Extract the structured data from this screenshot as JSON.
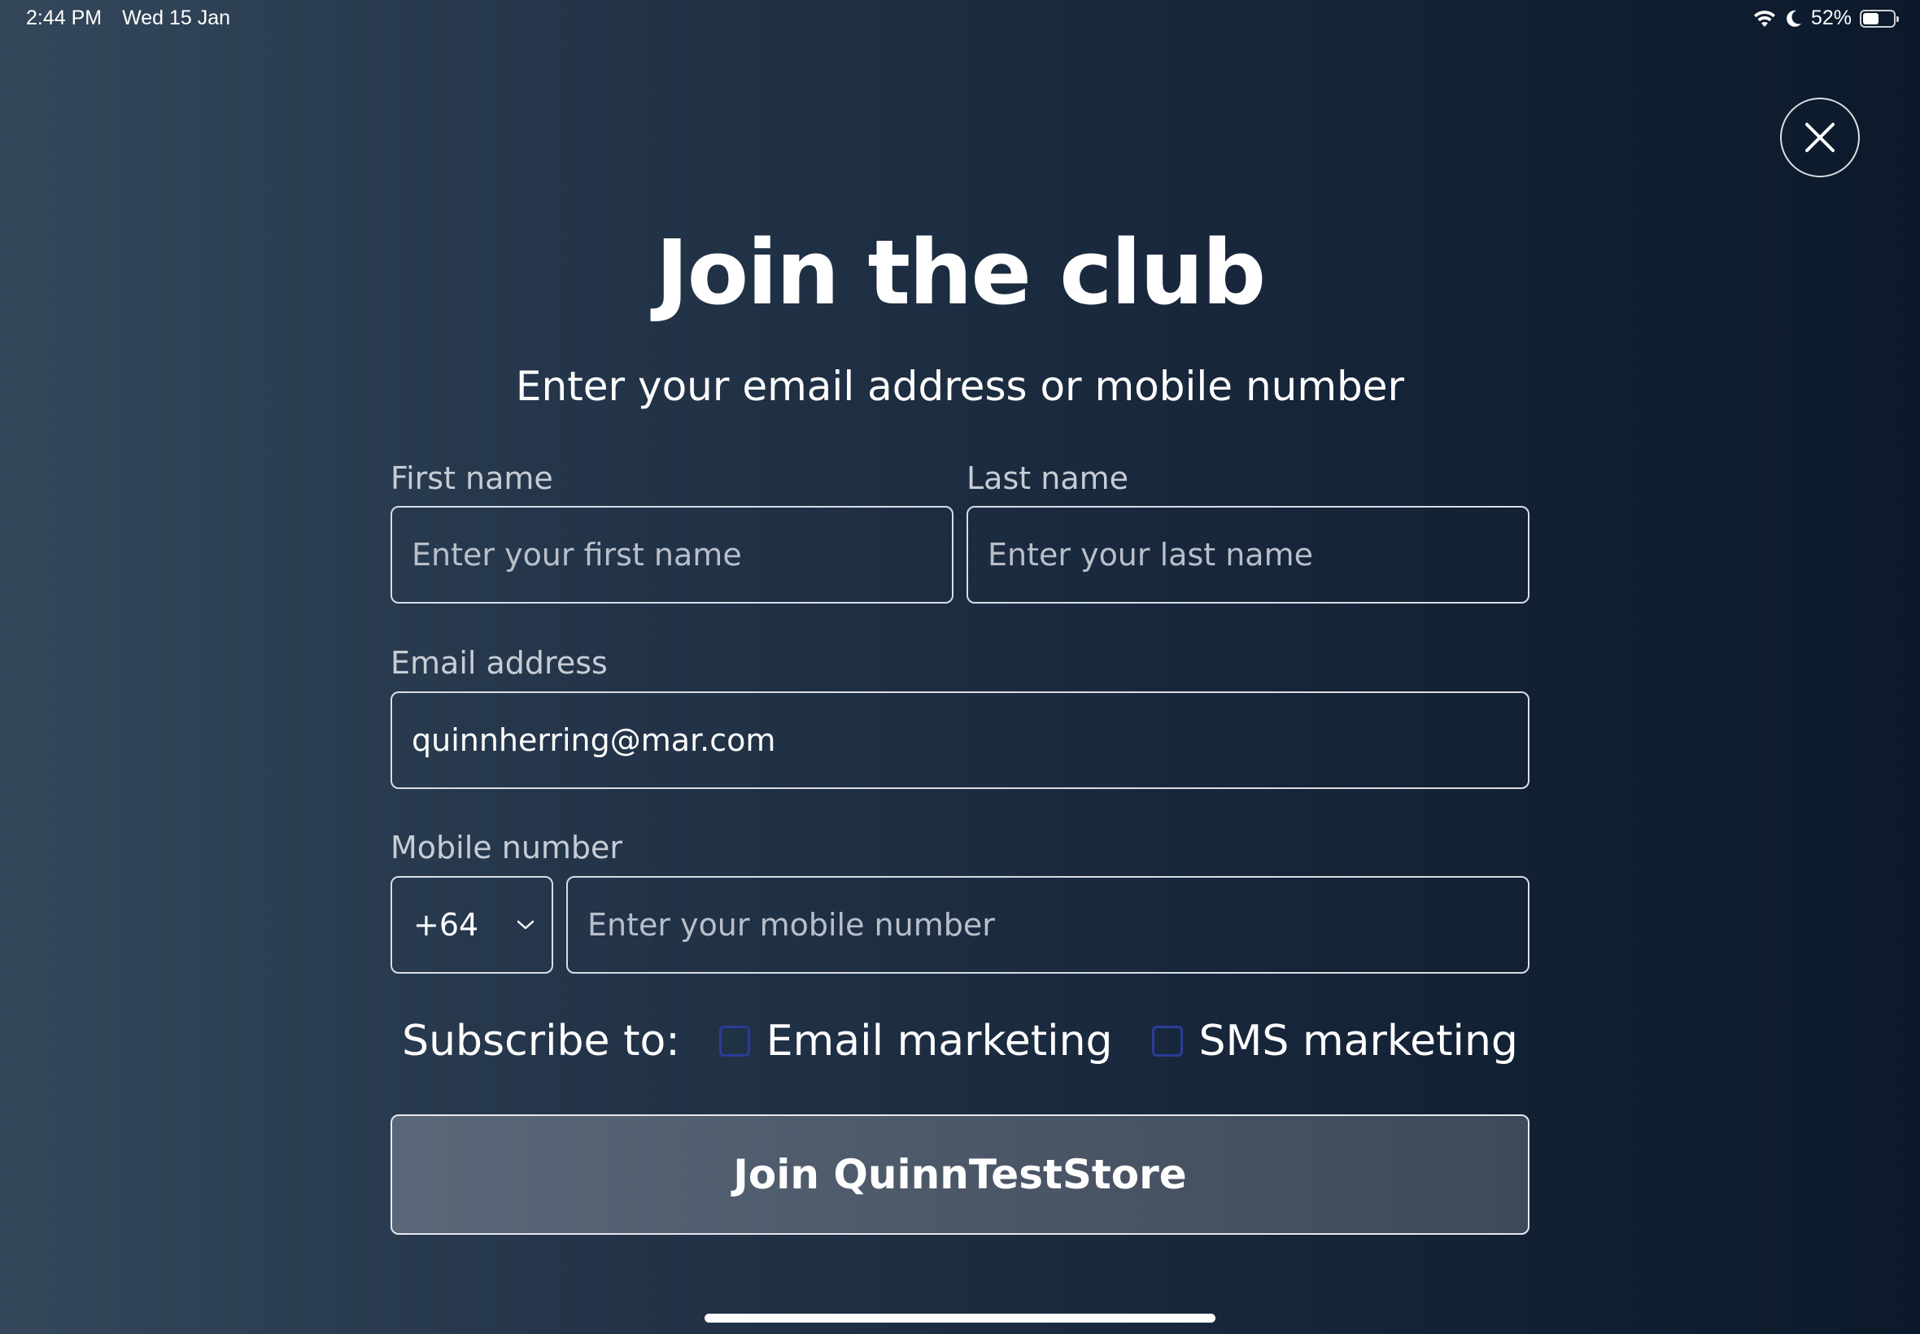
{
  "status_bar": {
    "time": "2:44 PM",
    "date": "Wed 15 Jan",
    "battery_percent": "52%",
    "battery_level": 0.52,
    "icons": [
      "wifi-icon",
      "moon-icon",
      "battery-icon"
    ]
  },
  "modal": {
    "close_icon": "close-icon",
    "title": "Join the club",
    "subtitle": "Enter your email address or mobile number"
  },
  "form": {
    "first_name": {
      "label": "First name",
      "placeholder": "Enter your first name",
      "value": ""
    },
    "last_name": {
      "label": "Last name",
      "placeholder": "Enter your last name",
      "value": ""
    },
    "email": {
      "label": "Email address",
      "placeholder": "",
      "value": "quinnherring@mar.com"
    },
    "mobile": {
      "label": "Mobile number",
      "country_code": "+64",
      "placeholder": "Enter your mobile number",
      "value": ""
    },
    "subscribe": {
      "label": "Subscribe to:",
      "options": [
        {
          "label": "Email marketing",
          "checked": false
        },
        {
          "label": "SMS marketing",
          "checked": false
        }
      ]
    },
    "submit_label": "Join QuinnTestStore"
  },
  "colors": {
    "background_start": "#34475b",
    "background_end": "#0b192b",
    "checkbox_border": "#2a3d9a",
    "button_fill": "#4c5868"
  }
}
